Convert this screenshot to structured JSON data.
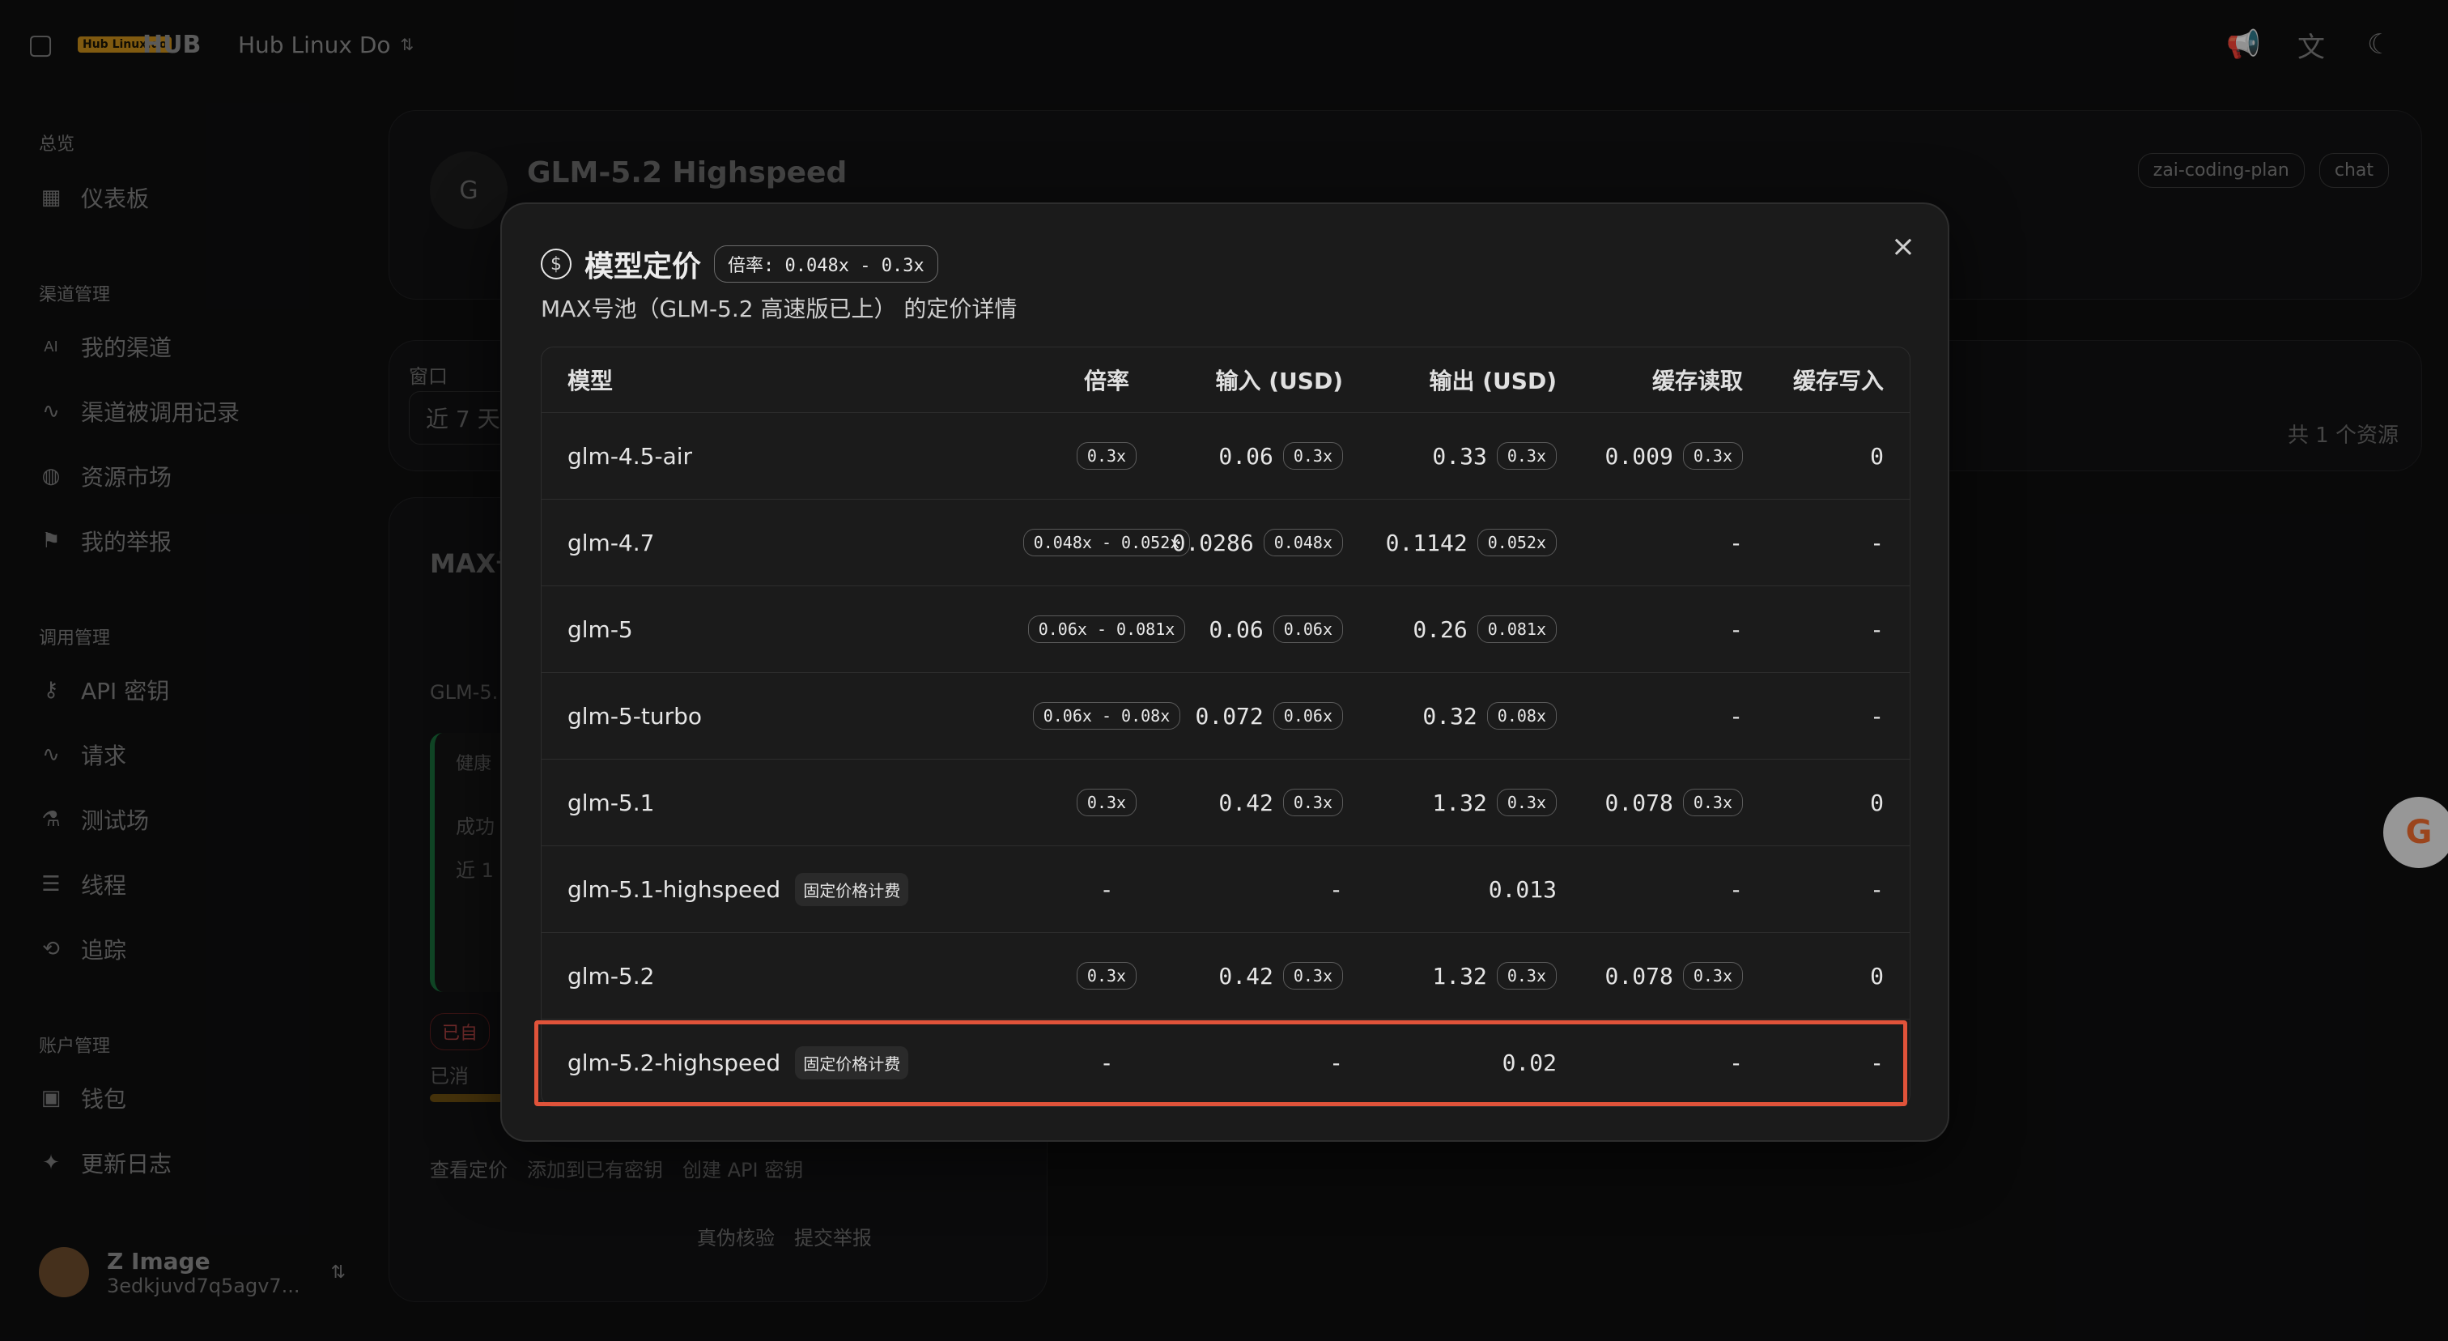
{
  "topbar": {
    "logo_text": "Hub Linux.do",
    "app_name": "HUB",
    "org_name": "Hub Linux Do",
    "chevron": "⌃⌄",
    "icons": {
      "sidebar_toggle": "sidebar-icon",
      "announce": "megaphone-icon",
      "translate": "translate-icon",
      "theme": "moon-icon"
    }
  },
  "sidebar": {
    "sections": [
      {
        "title": "总览",
        "items": [
          {
            "label": "仪表板",
            "icon": "dashboard-icon"
          }
        ]
      },
      {
        "title": "渠道管理",
        "items": [
          {
            "label": "我的渠道",
            "icon": "ai-icon"
          },
          {
            "label": "渠道被调用记录",
            "icon": "activity-icon"
          },
          {
            "label": "资源市场",
            "icon": "globe-icon"
          },
          {
            "label": "我的举报",
            "icon": "flag-icon"
          }
        ]
      },
      {
        "title": "调用管理",
        "items": [
          {
            "label": "API 密钥",
            "icon": "key-icon"
          },
          {
            "label": "请求",
            "icon": "activity-icon"
          },
          {
            "label": "测试场",
            "icon": "lab-icon"
          },
          {
            "label": "线程",
            "icon": "list-icon"
          },
          {
            "label": "追踪",
            "icon": "trace-icon"
          }
        ]
      },
      {
        "title": "账户管理",
        "items": [
          {
            "label": "钱包",
            "icon": "wallet-icon"
          },
          {
            "label": "更新日志",
            "icon": "sparkle-icon"
          }
        ]
      }
    ],
    "user": {
      "name": "Z Image",
      "sub": "3edkjuvd7q5agv7..."
    }
  },
  "background": {
    "model_header": "GLM-5.2 Highspeed",
    "avatar_letter": "G",
    "tags": [
      "zai-coding-plan",
      "chat"
    ],
    "window_label": "窗口",
    "window_value": "近 7 天",
    "resource_count": "共 1 个资源",
    "card_title": "MAX号",
    "card_sub": "GLM-5.",
    "health": "健康",
    "success": "成功",
    "recent": "近 1",
    "status": "已自",
    "consumed": "已消",
    "actions": [
      "查看定价",
      "添加到已有密钥",
      "创建 API 密钥",
      "真伪核验",
      "提交举报"
    ]
  },
  "modal": {
    "title": "模型定价",
    "badge": "倍率: 0.048x - 0.3x",
    "subtitle": "MAX号池（GLM-5.2 高速版已上） 的定价详情",
    "close": "×",
    "columns": [
      "模型",
      "倍率",
      "输入 (USD)",
      "输出 (USD)",
      "缓存读取",
      "缓存写入"
    ],
    "rows": [
      {
        "model": "glm-4.5-air",
        "fixed": "",
        "multi": "0.3x",
        "input": "0.06",
        "input_m": "0.3x",
        "output": "0.33",
        "output_m": "0.3x",
        "cread": "0.009",
        "cread_m": "0.3x",
        "cwrite": "0"
      },
      {
        "model": "glm-4.7",
        "fixed": "",
        "multi": "0.048x - 0.052x",
        "input": "0.0286",
        "input_m": "0.048x",
        "output": "0.1142",
        "output_m": "0.052x",
        "cread": "-",
        "cread_m": "",
        "cwrite": "-"
      },
      {
        "model": "glm-5",
        "fixed": "",
        "multi": "0.06x - 0.081x",
        "input": "0.06",
        "input_m": "0.06x",
        "output": "0.26",
        "output_m": "0.081x",
        "cread": "-",
        "cread_m": "",
        "cwrite": "-"
      },
      {
        "model": "glm-5-turbo",
        "fixed": "",
        "multi": "0.06x - 0.08x",
        "input": "0.072",
        "input_m": "0.06x",
        "output": "0.32",
        "output_m": "0.08x",
        "cread": "-",
        "cread_m": "",
        "cwrite": "-"
      },
      {
        "model": "glm-5.1",
        "fixed": "",
        "multi": "0.3x",
        "input": "0.42",
        "input_m": "0.3x",
        "output": "1.32",
        "output_m": "0.3x",
        "cread": "0.078",
        "cread_m": "0.3x",
        "cwrite": "0"
      },
      {
        "model": "glm-5.1-highspeed",
        "fixed": "固定价格计费",
        "multi": "-",
        "input": "-",
        "input_m": "",
        "output": "0.013",
        "output_m": "",
        "cread": "-",
        "cread_m": "",
        "cwrite": "-"
      },
      {
        "model": "glm-5.2",
        "fixed": "",
        "multi": "0.3x",
        "input": "0.42",
        "input_m": "0.3x",
        "output": "1.32",
        "output_m": "0.3x",
        "cread": "0.078",
        "cread_m": "0.3x",
        "cwrite": "0"
      },
      {
        "model": "glm-5.2-highspeed",
        "fixed": "固定价格计费",
        "multi": "-",
        "input": "-",
        "input_m": "",
        "output": "0.02",
        "output_m": "",
        "cread": "-",
        "cread_m": "",
        "cwrite": "-"
      }
    ]
  },
  "colors": {
    "highlight": "#e0533a"
  }
}
